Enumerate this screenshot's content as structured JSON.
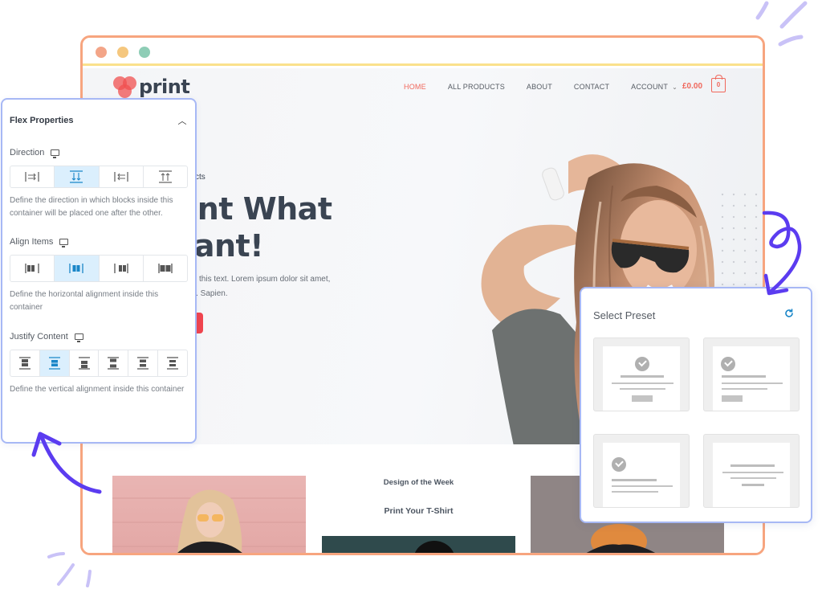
{
  "browser": {
    "window_controls": [
      "close",
      "minimize",
      "maximize"
    ]
  },
  "site": {
    "logo_text": "print",
    "nav": [
      {
        "label": "HOME",
        "active": true
      },
      {
        "label": "ALL PRODUCTS",
        "active": false
      },
      {
        "label": "ABOUT",
        "active": false
      },
      {
        "label": "CONTACT",
        "active": false
      },
      {
        "label": "ACCOUNT",
        "active": false,
        "has_dropdown": true
      }
    ],
    "cart_total": "£0.00",
    "cart_count": "0",
    "hero": {
      "eyebrow": "cts",
      "title_line1": "rint What",
      "title_line2": "Vant!",
      "text_line1": "ange this text. Lorem ipsum dolor sit amet,",
      "text_line2": "g elit. Sapien."
    },
    "products": {
      "middle_heading": "Design of the Week",
      "middle_subheading": "Print Your T-Shirt"
    }
  },
  "flex_panel": {
    "title": "Flex Properties",
    "collapse_icon": "chevron-up-icon",
    "sections": [
      {
        "label": "Direction",
        "device_icon": "monitor-icon",
        "options": [
          "row",
          "column",
          "row-reverse",
          "column-reverse"
        ],
        "selected": 1,
        "help": "Define the direction in which blocks inside this container will be placed one after the other."
      },
      {
        "label": "Align Items",
        "device_icon": "monitor-icon",
        "options": [
          "flex-start",
          "center",
          "flex-end",
          "stretch"
        ],
        "selected": 1,
        "help": "Define the horizontal alignment inside this container"
      },
      {
        "label": "Justify Content",
        "device_icon": "monitor-icon",
        "options": [
          "flex-start",
          "center",
          "flex-end",
          "space-between",
          "space-around",
          "space-evenly"
        ],
        "selected": 1,
        "help": "Define the vertical alignment inside this container"
      }
    ]
  },
  "preset_panel": {
    "title": "Select Preset",
    "refresh_icon": "refresh-icon",
    "presets": [
      "icon-title-text-button",
      "left-icon-title-text-button",
      "left-icon-title-text",
      "centered-text-lines"
    ]
  },
  "colors": {
    "accent_red": "#f0685c",
    "panel_border": "#a7b8f5",
    "selected_bg": "#dbeffd",
    "selected_icon": "#1a86c8",
    "browser_border": "#f7a57f",
    "arrow": "#5b3cf0"
  }
}
